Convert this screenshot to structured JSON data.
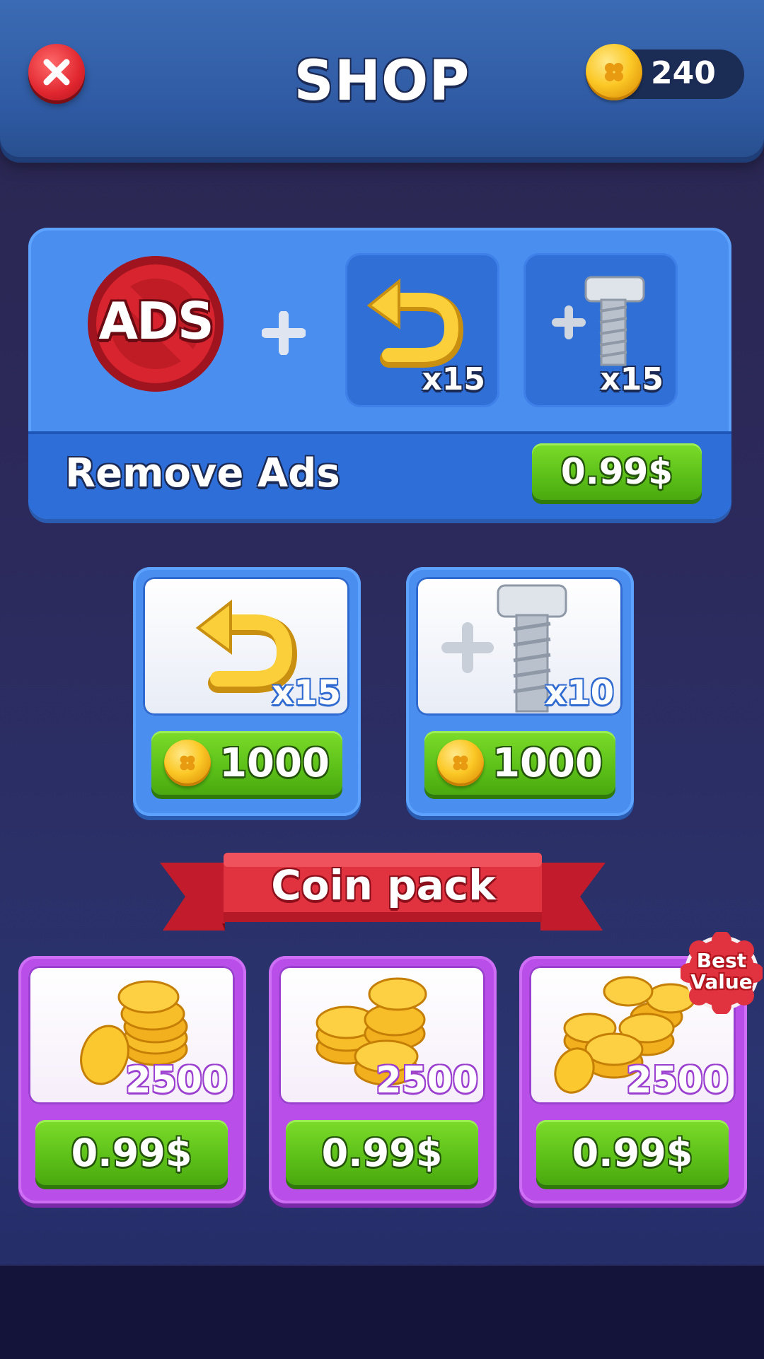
{
  "header": {
    "title": "SHOP",
    "coin_balance": "240"
  },
  "remove_ads": {
    "badge_text": "ADS",
    "undo_count": "x15",
    "screw_count": "x15",
    "label": "Remove Ads",
    "price": "0.99$"
  },
  "items": [
    {
      "count": "x15",
      "price": "1000",
      "icon": "undo-arrow-icon"
    },
    {
      "count": "x10",
      "price": "1000",
      "icon": "add-screw-icon"
    }
  ],
  "coin_pack": {
    "title": "Coin pack",
    "best_value_line1": "Best",
    "best_value_line2": "Value",
    "packs": [
      {
        "amount": "2500",
        "price": "0.99$"
      },
      {
        "amount": "2500",
        "price": "0.99$"
      },
      {
        "amount": "2500",
        "price": "0.99$"
      }
    ]
  },
  "colors": {
    "header": "#2f5aa3",
    "panel_blue": "#4a8ff0",
    "pack_purple": "#b94ee8",
    "button_green": "#5bbf18",
    "ribbon_red": "#d9283a"
  }
}
